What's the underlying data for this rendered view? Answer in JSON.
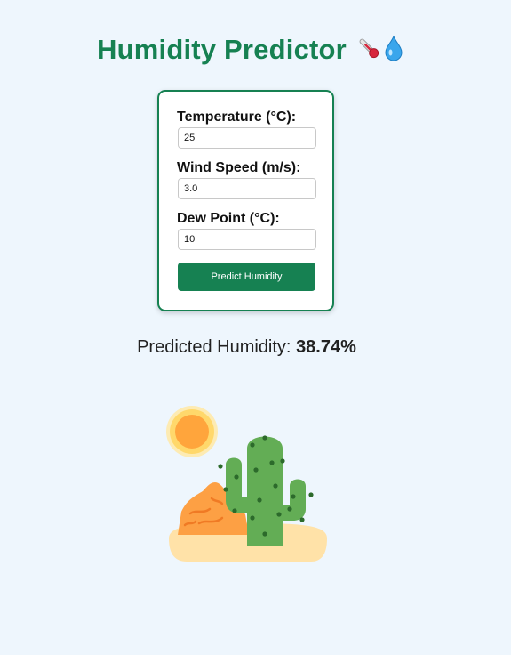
{
  "header": {
    "title": "Humidity Predictor",
    "icons": [
      "thermometer-icon",
      "droplet-icon"
    ]
  },
  "form": {
    "temperature": {
      "label": "Temperature (°C):",
      "value": "25"
    },
    "wind_speed": {
      "label": "Wind Speed (m/s):",
      "value": "3.0"
    },
    "dew_point": {
      "label": "Dew Point (°C):",
      "value": "10"
    },
    "submit_label": "Predict Humidity"
  },
  "result": {
    "prefix": "Predicted Humidity:",
    "value": "38.74%"
  },
  "illustration": {
    "name": "desert-cactus-illustration",
    "colors": {
      "brand_green": "#168152",
      "sun": "#ffa53c",
      "cactus": "#63ad55",
      "rock": "#fda044",
      "sand": "#ffe2a8"
    }
  }
}
